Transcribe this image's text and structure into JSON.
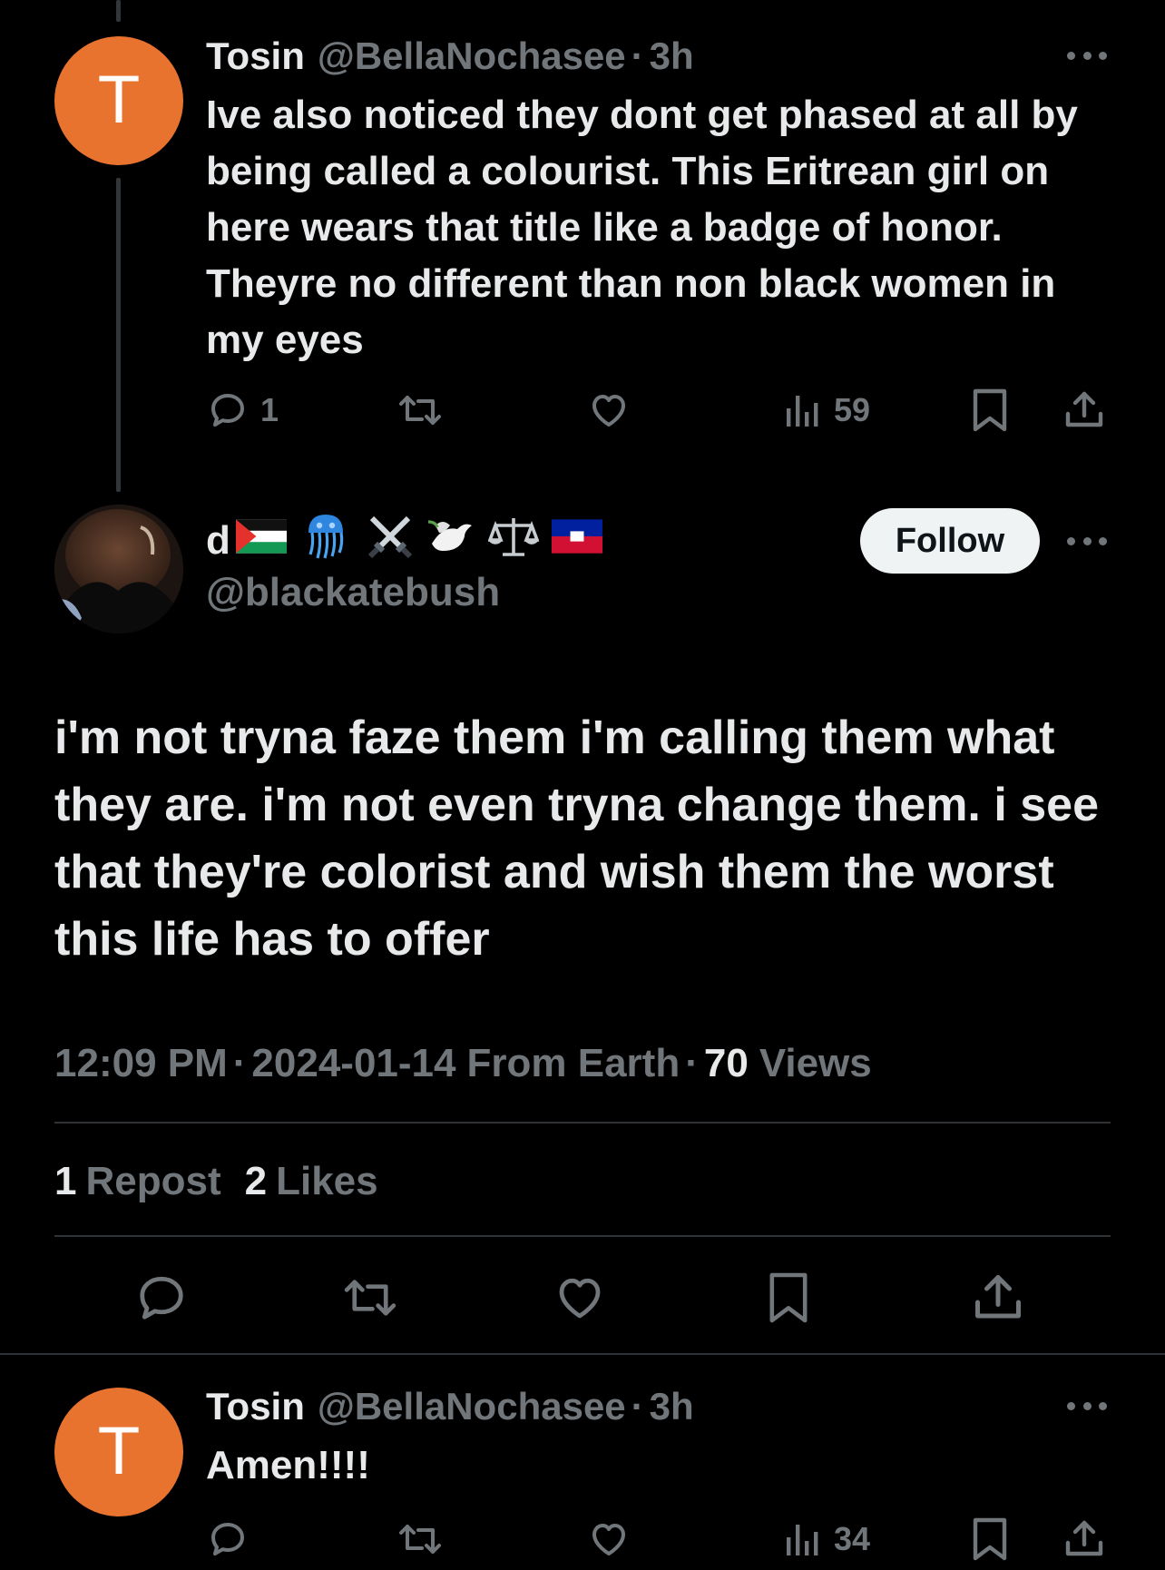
{
  "colors": {
    "background": "#000000",
    "text_primary": "#e7e9ea",
    "text_secondary": "#71767b",
    "divider": "#2f3336",
    "avatar_orange": "#e8732f",
    "follow_bg": "#eff3f4"
  },
  "reply_above": {
    "avatar_letter": "T",
    "display_name": "Tosin",
    "handle": "@BellaNochasee",
    "separator": "·",
    "time": "3h",
    "text": "Ive also noticed they dont get phased at all by being called a colourist. This Eritrean girl on here wears that title like a badge of honor. Theyre no different than non black women in my eyes",
    "actions": {
      "reply_count": "1",
      "repost_count": "",
      "like_count": "",
      "views_count": "59"
    }
  },
  "main_tweet": {
    "display_name": "d",
    "name_emojis": [
      "palestine-flag",
      "jellyfish",
      "crossed-swords",
      "dove",
      "balance-scale",
      "haiti-flag"
    ],
    "handle": "@blackatebush",
    "follow_label": "Follow",
    "text": "i'm not tryna faze them i'm calling them what they are. i'm not even tryna change them. i see that they're colorist and wish them the worst this life has to offer",
    "time": "12:09 PM",
    "separator": "·",
    "date": "2024-01-14",
    "source": "From Earth",
    "views_count": "70",
    "views_label": "Views",
    "repost_count": "1",
    "repost_label": "Repost",
    "likes_count": "2",
    "likes_label": "Likes"
  },
  "reply_below": {
    "avatar_letter": "T",
    "display_name": "Tosin",
    "handle": "@BellaNochasee",
    "separator": "·",
    "time": "3h",
    "text": "Amen!!!!",
    "actions": {
      "views_count": "34"
    }
  }
}
